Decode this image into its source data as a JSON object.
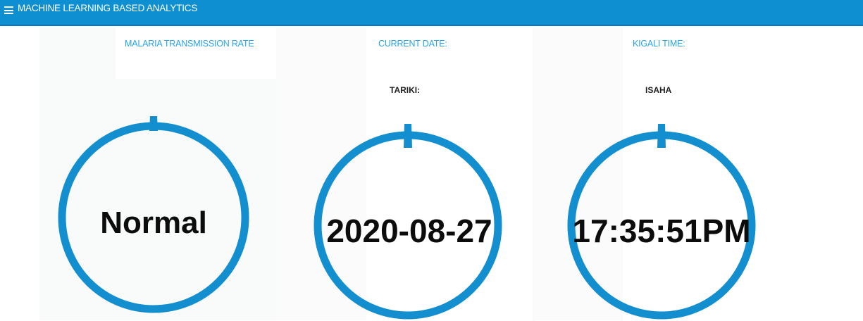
{
  "header": {
    "title": "MACHINE LEARNING BASED ANALYTICS",
    "menu_icon": "hamburger-menu-icon"
  },
  "colors": {
    "header": "#0d8fd2",
    "accent": "#28a4e6",
    "ring": "#138fd0"
  },
  "sections": [
    {
      "title": "MALARIA TRANSMISSION RATE",
      "sublabel": "",
      "value": "Normal"
    },
    {
      "title": "CURRENT DATE:",
      "sublabel": "TARIKI:",
      "value": "2020-08-27"
    },
    {
      "title": "KIGALI TIME:",
      "sublabel": "ISAHA",
      "value": "17:35:51PM"
    }
  ]
}
